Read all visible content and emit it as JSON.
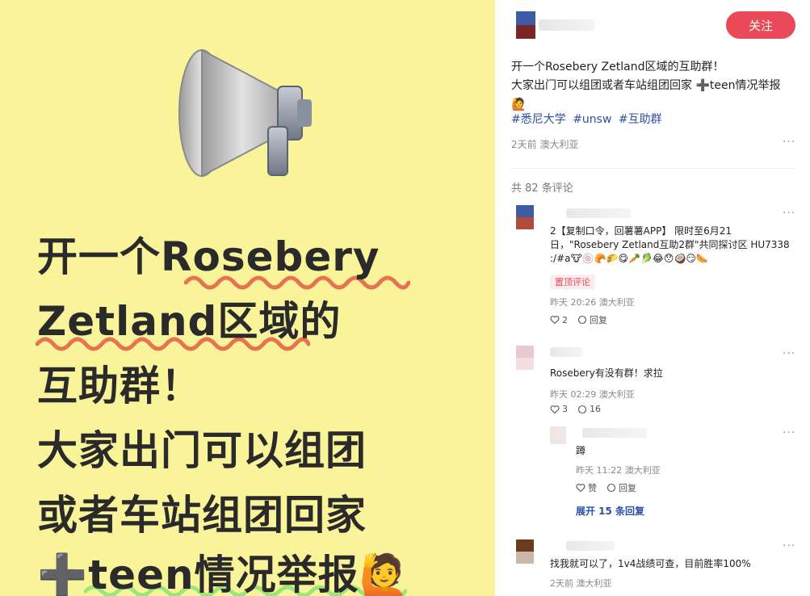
{
  "poster": {
    "line1": "开一个Rosebery",
    "line2": "Zetland区域的",
    "line3": "互助群！",
    "line4": "大家出门可以组团",
    "line5": "或者车站组团回家",
    "line6": "➕teen情况举报🙋"
  },
  "post": {
    "follow_label": "关注",
    "text_line1": "开一个Rosebery Zetland区域的互助群！",
    "text_line2": "大家出门可以组团或者车站组团回家 ➕teen情况举报",
    "text_emoji": "🙋",
    "tags": [
      "#悉尼大学",
      "#unsw",
      "#互助群"
    ],
    "meta": "2天前 澳大利亚",
    "more": "···",
    "comment_count": "共 82 条评论"
  },
  "comments": [
    {
      "text": "2【复制口令，回薯薯APP】 限时至6月21日，\"Rosebery Zetland互助2群\"共同探讨区 HU7338 :/#a🐮🍥🥐🌮😋🥕🥬😂😯🥥😏🌭",
      "pin": "置顶评论",
      "meta": "昨天 20:26 澳大利亚",
      "likes": "2",
      "reply": "回复"
    },
    {
      "text": "Rosebery有没有群！求拉",
      "meta": "昨天 02:29 澳大利亚",
      "likes": "3",
      "replies": "16"
    },
    {
      "text": "蹲",
      "meta": "昨天 11:22 澳大利亚",
      "like_label": "赞",
      "reply": "回复"
    },
    {
      "text": "找我就可以了，1v4战绩可查，目前胜率100%",
      "meta": "2天前 澳大利亚"
    }
  ],
  "expand_label": "展开 15 条回复",
  "colors": {
    "poster_bg": "#f9f39a",
    "accent": "#ea4a57",
    "link": "#2c4fa3"
  }
}
